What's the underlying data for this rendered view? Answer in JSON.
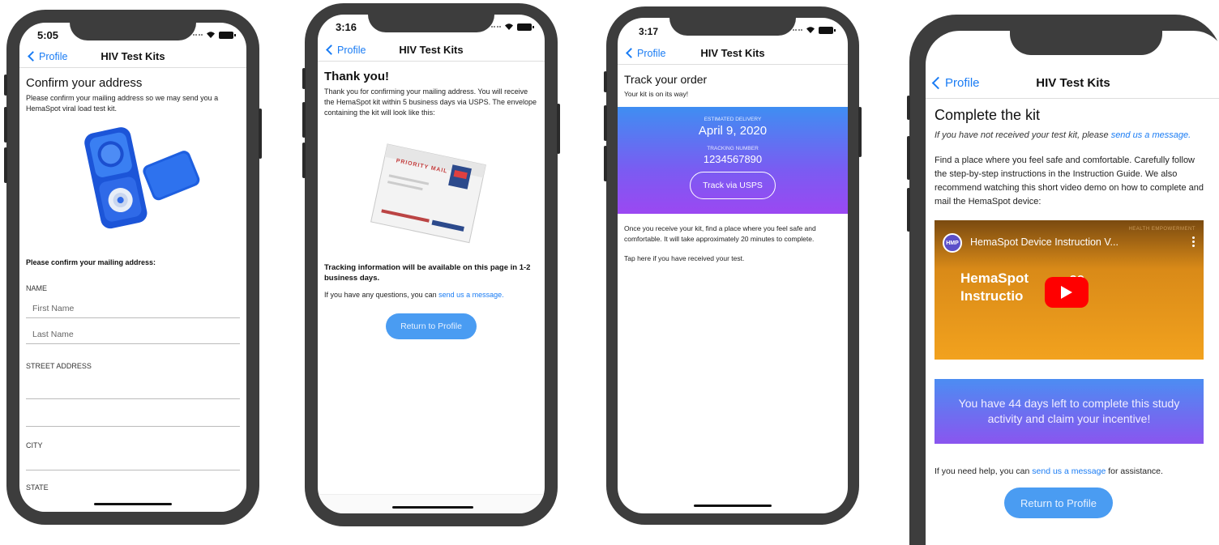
{
  "nav": {
    "back_label": "Profile",
    "title": "HIV Test Kits"
  },
  "screen1": {
    "time": "5:05",
    "heading": "Confirm your address",
    "intro": "Please confirm your mailing address so we may send you a HemaSpot viral load test kit.",
    "section_label": "Please confirm your mailing address:",
    "name_label": "NAME",
    "first_name_placeholder": "First Name",
    "last_name_placeholder": "Last Name",
    "street_label": "STREET ADDRESS",
    "city_label": "CITY",
    "state_label": "STATE"
  },
  "screen2": {
    "time": "3:16",
    "heading": "Thank you!",
    "body": "Thank you for confirming your mailing address. You will receive the HemaSpot kit within 5 business days via USPS. The envelope containing the kit will look like this:",
    "envelope_text": "PRIORITY MAIL",
    "tracking_note": "Tracking information will be available on this page in 1-2 business days.",
    "questions_prefix": "If you have any questions, you can ",
    "questions_link": "send us a message.",
    "return_button": "Return to Profile"
  },
  "screen3": {
    "time": "3:17",
    "heading": "Track your order",
    "subheading": "Your kit is on its way!",
    "delivery_label": "ESTIMATED DELIVERY",
    "delivery_date": "April 9, 2020",
    "tracking_label": "TRACKING NUMBER",
    "tracking_number": "1234567890",
    "track_button": "Track via USPS",
    "body": "Once you receive your kit, find a place where you feel safe and comfortable. It will take approximately 20 minutes to complete.",
    "received_link": "Tap here if you have received your test."
  },
  "screen4": {
    "heading": "Complete the kit",
    "not_received_prefix": "If you have not received your test kit, please ",
    "not_received_link": "send us a message.",
    "body": "Find a place where you feel safe and comfortable. Carefully follow the step-by-step instructions in the Instruction Guide. We also recommend watching this short video demo on how to complete and mail the HemaSpot device:",
    "video_title": "HemaSpot Device Instruction V...",
    "video_channel_badge": "HMP",
    "video_watermark": "HEALTH EMPOWERMENT",
    "video_overlay_line1": "HemaSpot",
    "video_overlay_line1_tail": "ce",
    "video_overlay_line2": "Instructio",
    "video_overlay_line2_tail": "o",
    "incentive_text": "You have 44 days left to complete this study activity and claim your incentive!",
    "help_prefix": "If you need help, you can ",
    "help_link": "send us a message",
    "help_suffix": " for assistance.",
    "return_button": "Return to Profile"
  },
  "icons": {
    "back": "chevron-left-icon",
    "wifi": "wifi-icon",
    "battery": "battery-icon",
    "signal": "signal-dots-icon",
    "play": "play-icon",
    "more": "more-vertical-icon"
  },
  "colors": {
    "link": "#1a7cf4",
    "button": "#4a9cf2",
    "gradient_start": "#3f8ef2",
    "gradient_end": "#9b48f2",
    "video_bg": "#f0a020",
    "play_red": "#ff0000"
  }
}
